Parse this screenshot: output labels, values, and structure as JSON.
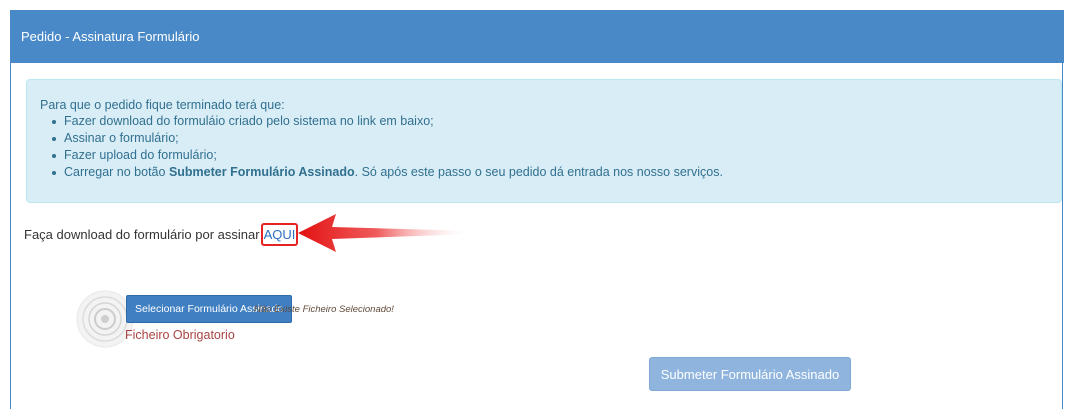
{
  "panel": {
    "title": "Pedido - Assinatura Formulário"
  },
  "info": {
    "intro": "Para que o pedido fique terminado terá que:",
    "steps": [
      "Fazer download do formuláio criado pelo sistema no link em baixo;",
      "Assinar o formulário;",
      "Fazer upload do formulário;"
    ],
    "last_step_prefix": "Carregar no botão ",
    "last_step_bold": "Submeter Formulário Assinado",
    "last_step_suffix": ". Só após este passo o seu pedido dá entrada nos nosso serviços."
  },
  "download": {
    "text": "Faça download do formulário por assinar",
    "link_label": "AQUI"
  },
  "upload": {
    "select_label": "Selecionar Formulário Assinado",
    "no_file_text": "Não Existe Ficheiro Selecionado!",
    "required_text": "Ficheiro Obrigatorio"
  },
  "submit": {
    "label": "Submeter Formulário Assinado"
  },
  "colors": {
    "header_bg": "#4a89c8",
    "info_bg": "#d9edf7",
    "info_text": "#31708f",
    "arrow": "#e62222",
    "error_text": "#a94442",
    "submit_disabled_bg": "#8fb5df"
  },
  "icons": {
    "arrow": "red-pointer-arrow-icon",
    "ripple": "click-ripple-icon"
  }
}
